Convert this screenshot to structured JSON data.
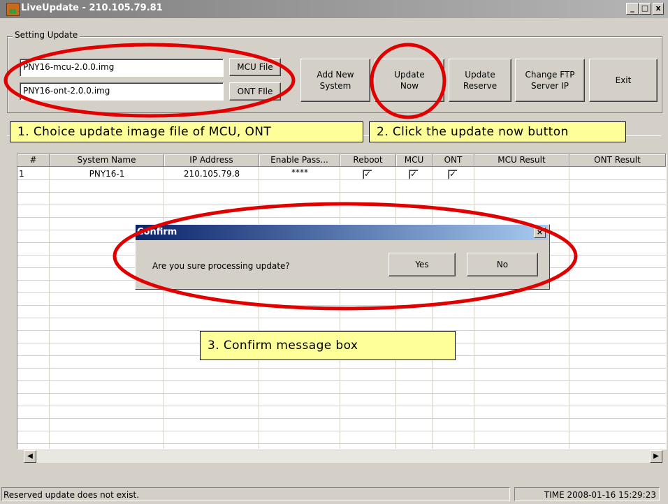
{
  "window": {
    "title": "LiveUpdate - 210.105.79.81",
    "minimize_label": "_",
    "maximize_label": "□",
    "close_label": "x"
  },
  "settings": {
    "legend": "Setting Update",
    "mcu_file_value": "PNY16-mcu-2.0.0.img",
    "ont_file_value": "PNY16-ont-2.0.0.img",
    "mcu_file_button": "MCU File",
    "ont_file_button": "ONT FIle"
  },
  "toolbar": {
    "add_new_system": "Add New System",
    "update_now": "Update Now",
    "update_reserve": "Update Reserve",
    "change_ftp": "Change FTP Server IP",
    "exit": "Exit"
  },
  "callouts": {
    "step1": "1. Choice update image file of MCU, ONT",
    "step2": "2. Click the update now button",
    "step3": "3. Confirm message box"
  },
  "table": {
    "columns": [
      "#",
      "System Name",
      "IP Address",
      "Enable Pass...",
      "Reboot",
      "MCU",
      "ONT",
      "MCU Result",
      "ONT Result"
    ],
    "rows": [
      {
        "index": "1",
        "system_name": "PNY16-1",
        "ip_address": "210.105.79.8",
        "enable_pass": "****",
        "reboot": true,
        "mcu": true,
        "ont": true,
        "mcu_result": "",
        "ont_result": ""
      }
    ]
  },
  "dialog": {
    "title": "Confirm",
    "message": "Are you sure processing update?",
    "yes_label": "Yes",
    "no_label": "No",
    "close_label": "×"
  },
  "status": {
    "left": "Reserved update does not exist.",
    "right": "TIME 2008-01-16 15:29:23"
  },
  "colors": {
    "callout_bg": "#ffff99",
    "annotation_red": "#e00000",
    "dialog_title": "#0a246a"
  }
}
